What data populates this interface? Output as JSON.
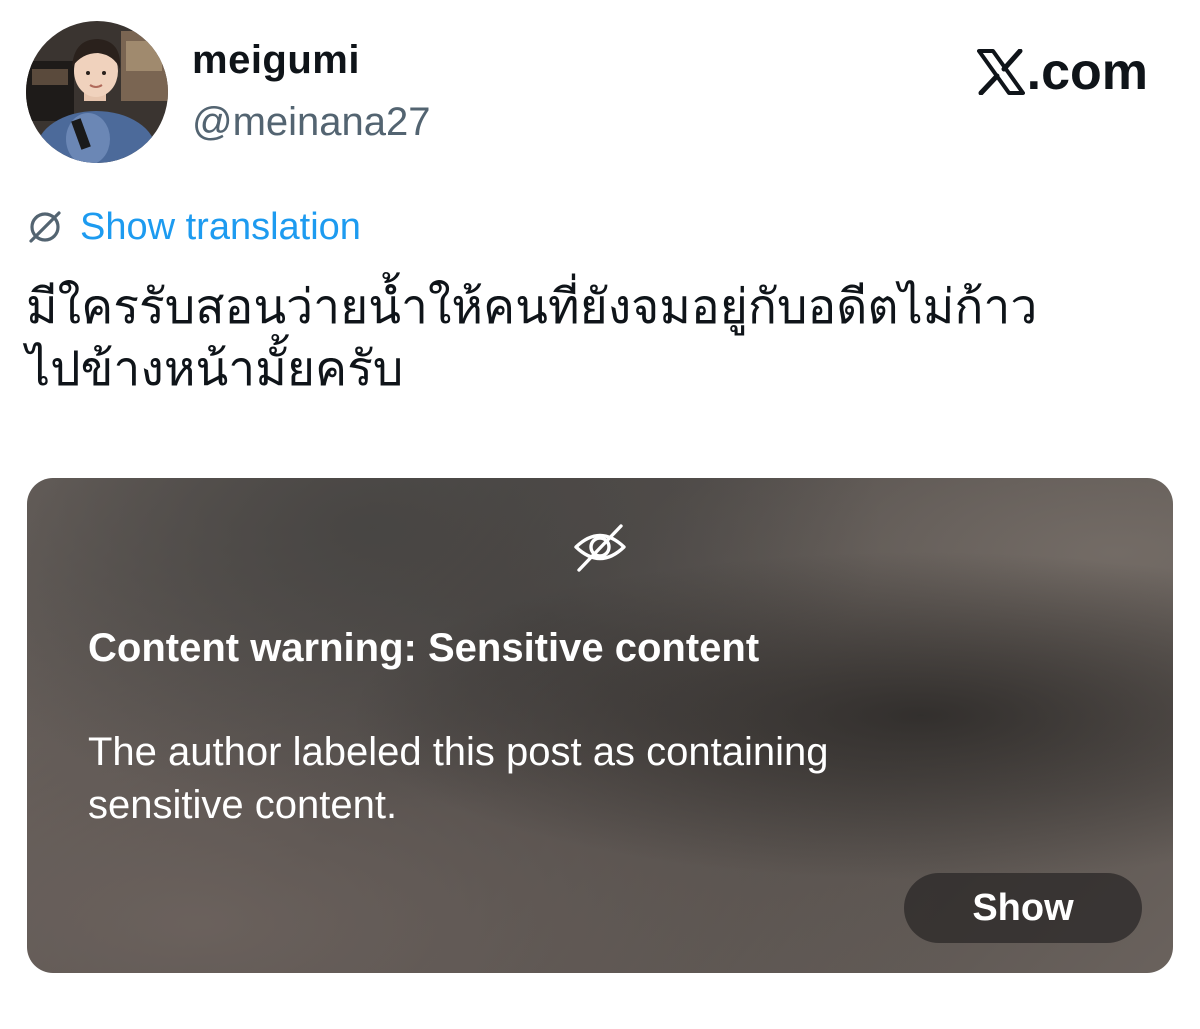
{
  "author": {
    "display_name": "meigumi",
    "handle": "@meinana27",
    "avatar_icon": "profile-photo"
  },
  "brand": {
    "logo_icon": "x-logo-icon",
    "text": ".com"
  },
  "translation": {
    "icon": "globe-slash-icon",
    "label": "Show translation",
    "color": "#1d9bf0"
  },
  "post": {
    "lines": [
      "มีใครรับสอนว่ายน้ำให้คนที่ยังจมอยู่กับอดีตไม่ก้าว",
      "ไปข้างหน้ามั้ยครับ"
    ]
  },
  "content_warning": {
    "icon": "eye-slash-icon",
    "title": "Content warning: Sensitive content",
    "body": "The author labeled this post as containing sensitive content.",
    "show_label": "Show"
  }
}
